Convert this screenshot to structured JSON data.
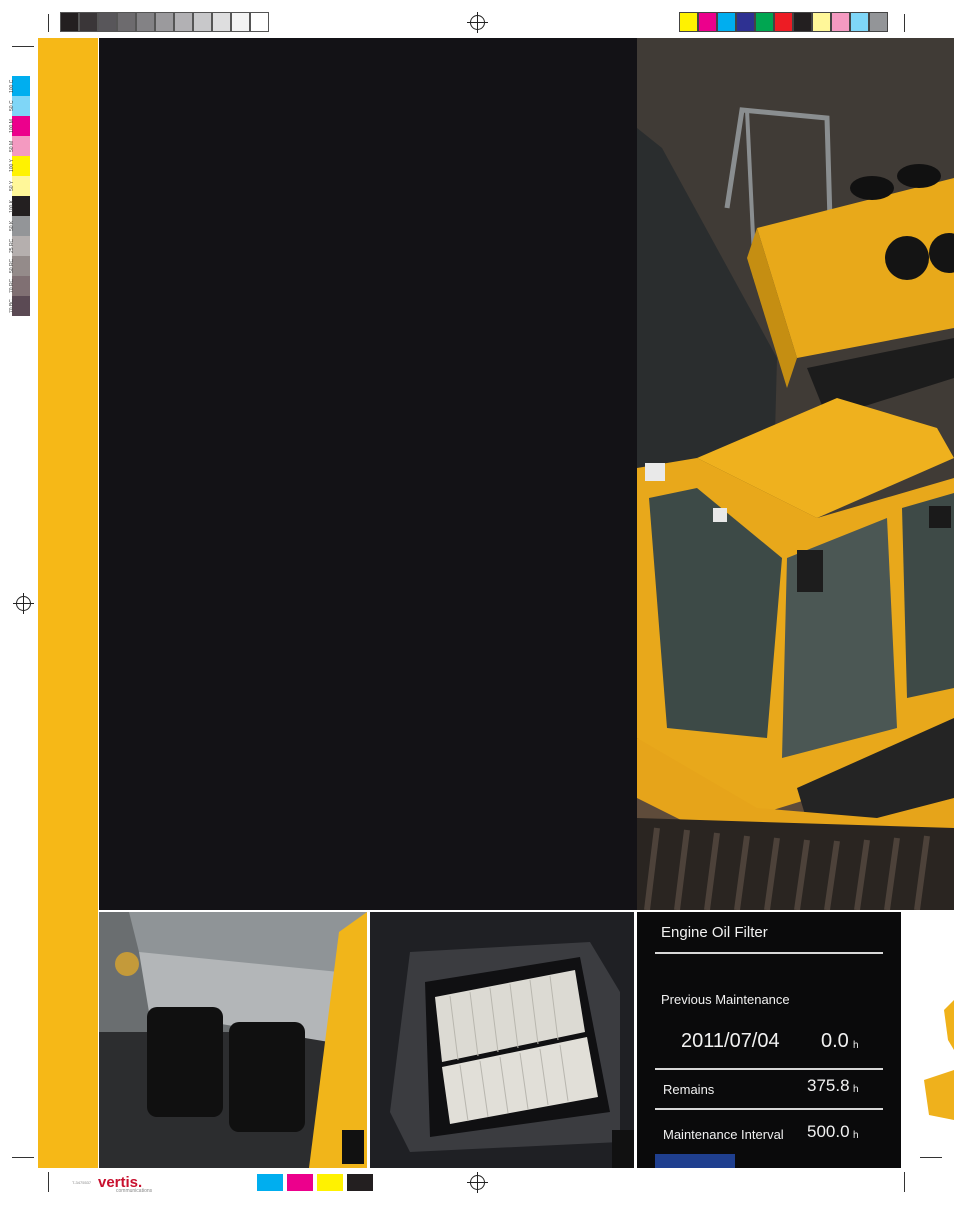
{
  "print_marks": {
    "gray_steps": [
      "#231f20",
      "#3a3638",
      "#58565a",
      "#6d6b6e",
      "#838285",
      "#9b9a9d",
      "#b2b1b4",
      "#c8c8ca",
      "#dededf",
      "#f3f3f3",
      "#ffffff"
    ],
    "color_bar": [
      "#fff200",
      "#ec008c",
      "#00aeef",
      "#2e3192",
      "#00a651",
      "#ed1c24",
      "#231f20",
      "#fff799",
      "#f49ac1",
      "#7fd6f7",
      "#939598"
    ],
    "side_swatches": [
      "#00aeef",
      "#7fd6f7",
      "#ec008c",
      "#f49ac1",
      "#fff200",
      "#fff799",
      "#231f20",
      "#939598",
      "#b5afae",
      "#948b8a",
      "#807073",
      "#5b4a54"
    ],
    "side_labels": [
      "100 C",
      "50 C",
      "100 M",
      "50 M",
      "100 Y",
      "50 Y",
      "100 K",
      "50 K",
      "25 RC",
      "50 RC",
      "70 RC",
      "70 BC"
    ],
    "bottom_swatches": [
      "#00aeef",
      "#ec008c",
      "#fff200",
      "#231f20"
    ],
    "printer_logo": "vertis.",
    "printer_sub": "communications",
    "job_code": "T-3475537"
  },
  "theme": {
    "accent_yellow": "#f6b817",
    "dark_panel": "#131216"
  },
  "photos": {
    "hero": "excavator-cab-photo",
    "bottom_left": "fuel-filter-photo",
    "bottom_middle": "cab-air-filter-photo",
    "bottom_right": "monitor-display-photo"
  },
  "monitor": {
    "title": "Engine Oil Filter",
    "previous_label": "Previous Maintenance",
    "previous_date": "2011/07/04",
    "previous_hours": "0.0",
    "remains_label": "Remains",
    "remains_hours": "375.8",
    "interval_label": "Maintenance Interval",
    "interval_hours": "500.0",
    "unit": "h"
  }
}
